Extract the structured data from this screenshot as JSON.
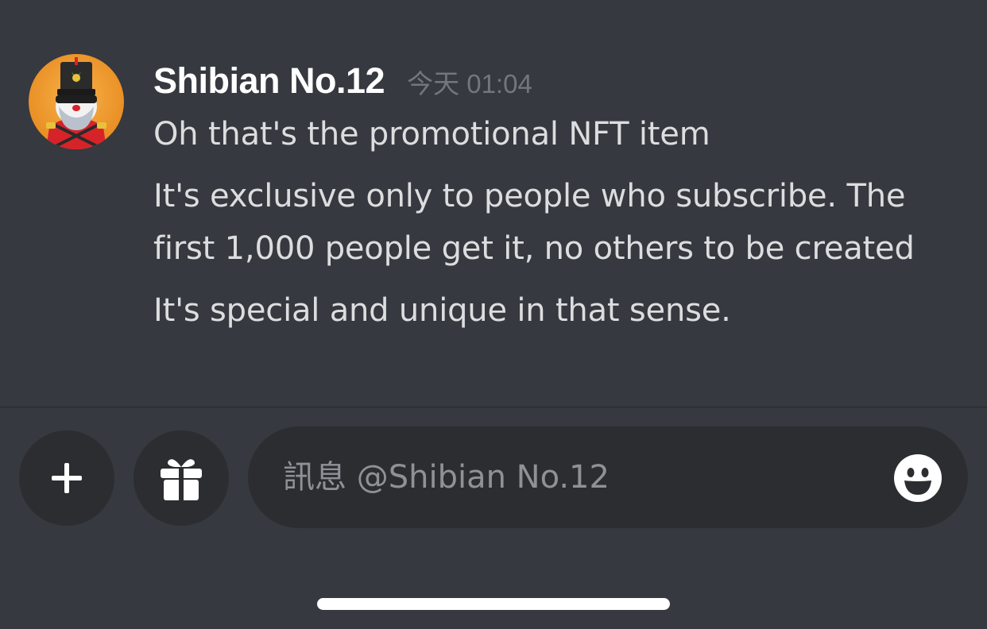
{
  "message": {
    "author": "Shibian No.12",
    "timestamp": "今天 01:04",
    "lines": [
      "Oh that's the promotional NFT item",
      "It's exclusive only to people who subscribe. The",
      "first 1,000 people get it, no others to be created",
      "It's special and unique in that sense."
    ],
    "avatar_icon": "shiba-soldier-avatar"
  },
  "composer": {
    "placeholder": "訊息 @Shibian No.12",
    "add_icon": "plus-icon",
    "gift_icon": "gift-icon",
    "emoji_icon": "smiley-emoji-icon"
  },
  "colors": {
    "background": "#36393f",
    "input_background": "#2b2d31",
    "author": "#ffffff",
    "text": "#dcddde",
    "muted": "#72767d"
  }
}
